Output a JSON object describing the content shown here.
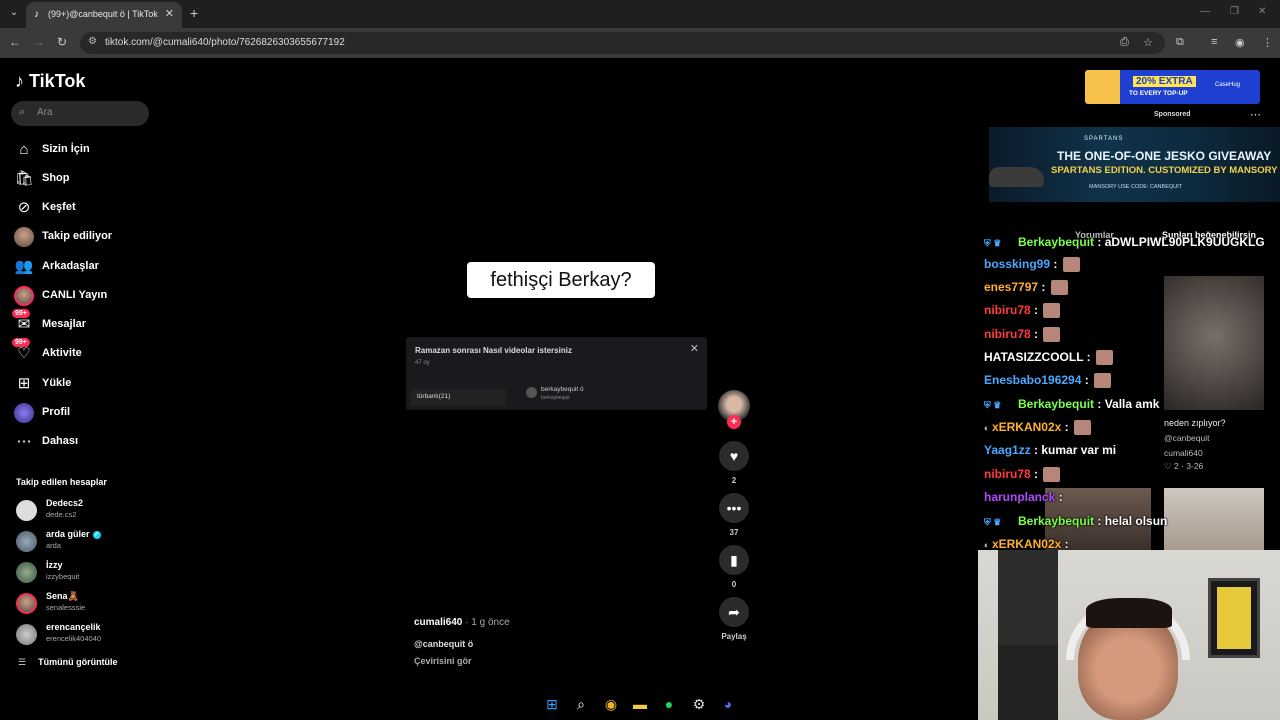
{
  "browser": {
    "tab_title": "(99+)@canbequit ö | TikTok",
    "url": "tiktok.com/@cumali640/photo/7626826303655677192"
  },
  "sidebar": {
    "logo": "TikTok",
    "search_placeholder": "Ara",
    "items": [
      {
        "label": "Sizin İçin",
        "icon": "home-icon"
      },
      {
        "label": "Shop",
        "icon": "shop-icon"
      },
      {
        "label": "Keşfet",
        "icon": "compass-icon"
      },
      {
        "label": "Takip ediliyor",
        "icon": "following-avatar-icon"
      },
      {
        "label": "Arkadaşlar",
        "icon": "friends-icon"
      },
      {
        "label": "CANLI Yayın",
        "icon": "live-icon"
      },
      {
        "label": "Mesajlar",
        "icon": "messages-icon",
        "badge": "99+"
      },
      {
        "label": "Aktivite",
        "icon": "activity-icon",
        "badge": "99+"
      },
      {
        "label": "Yükle",
        "icon": "upload-icon"
      },
      {
        "label": "Profil",
        "icon": "profile-icon"
      },
      {
        "label": "Dahası",
        "icon": "more-icon"
      }
    ],
    "following_header": "Takip edilen hesaplar",
    "following": [
      {
        "name": "Dedecs2",
        "username": "dede.cs2"
      },
      {
        "name": "arda güler",
        "username": "arda",
        "verified": true
      },
      {
        "name": "İzzy",
        "username": "izzybequit"
      },
      {
        "name": "Sena🧸",
        "username": "senalesssie"
      },
      {
        "name": "erencançelik",
        "username": "erencelik404040"
      }
    ],
    "show_all": "Tümünü görüntüle"
  },
  "post": {
    "overlay_text": "fethişçi Berkay?",
    "poll": {
      "question": "Ramazan sonrası Nasıl videolar istersiniz",
      "votes": "47 oy",
      "option": "türbanlı(21)",
      "author_name": "berkaybequit ö",
      "author_user": "berkaybequit"
    },
    "likes": "2",
    "comments": "37",
    "saves": "0",
    "share_label": "Paylaş",
    "author": "cumali640",
    "time": " · 1 g önce",
    "description": "@canbequit ö",
    "translate": "Çevirisini gör"
  },
  "right": {
    "sponsored": "Sponsored",
    "ad_top_pct": "20% EXTRA",
    "ad_top_sub": "TO EVERY TOP-UP",
    "ad_top_brand": "CaseHug",
    "banner_brand": "SPARTANS",
    "banner_t1": "THE ONE-OF-ONE JESKO GIVEAWAY",
    "banner_t2": "SPARTANS EDITION. CUSTOMIZED BY MANSORY",
    "banner_t3": "MANSORY   USE CODE: CANBEQUIT",
    "tab_comments": "Yorumlar",
    "tab_like": "Şunları beğenebilirsin",
    "thumb1_caption": "neden zıplıyor?",
    "thumb1_user": "@canbequit",
    "thumb1_author": "cumali640",
    "thumb1_stats": "♡ 2 · 3-26"
  },
  "chat": [
    {
      "user": "Berkaybequit",
      "color": "#7cff4a",
      "badges": true,
      "msg": "aDWLPIWL90PLK9UUGKLG"
    },
    {
      "user": "bossking99",
      "color": "#4aa8ff",
      "msg": ""
    },
    {
      "user": "enes7797",
      "color": "#ffb02e",
      "msg": ""
    },
    {
      "user": "nibiru78",
      "color": "#ff3b3b",
      "msg": ""
    },
    {
      "user": "nibiru78",
      "color": "#ff3b3b",
      "msg": ""
    },
    {
      "user": "HATASIZZCOOLL",
      "color": "#ffffff",
      "msg": ""
    },
    {
      "user": "Enesbabo196294",
      "color": "#4aa8ff",
      "msg": ""
    },
    {
      "user": "Berkaybequit",
      "color": "#7cff4a",
      "badges": true,
      "msg": "Valla amk"
    },
    {
      "user": "xERKAN02x",
      "color": "#ffb02e",
      "msg": ""
    },
    {
      "user": "Yaag1zz",
      "color": "#4aa8ff",
      "msg": "kumar var mi"
    },
    {
      "user": "nibiru78",
      "color": "#ff3b3b",
      "msg": ""
    },
    {
      "user": "harunplanck",
      "color": "#b04aff",
      "msg": ""
    },
    {
      "user": "Berkaybequit",
      "color": "#7cff4a",
      "badges": true,
      "msg": "helal olsun"
    },
    {
      "user": "xERKAN02x",
      "color": "#ffb02e",
      "msg": ""
    }
  ]
}
